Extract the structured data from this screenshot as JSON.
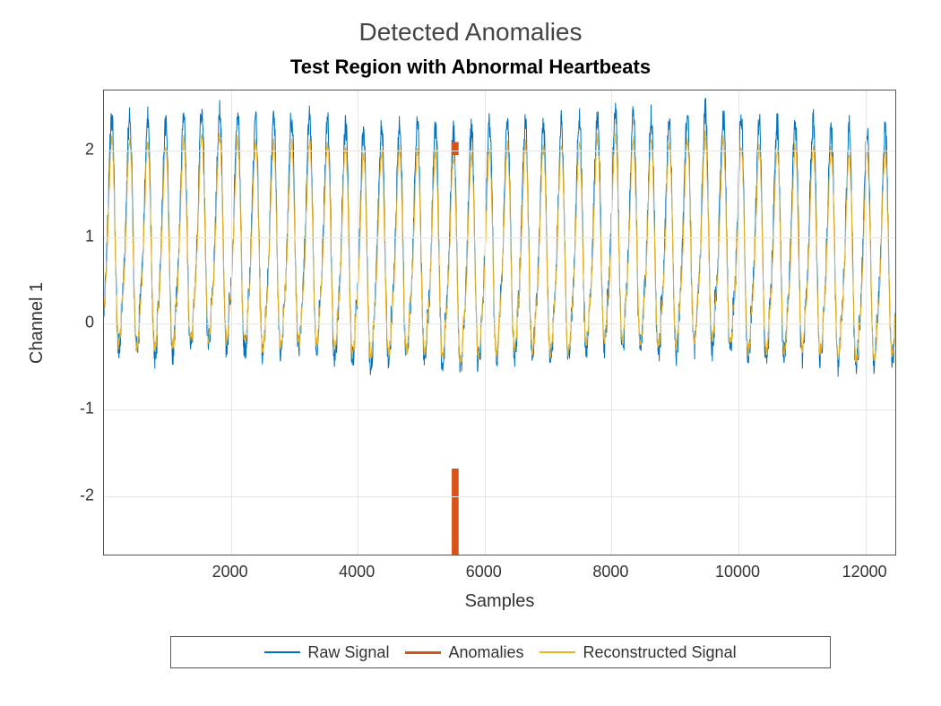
{
  "suptitle": "Detected Anomalies",
  "chart_data": {
    "type": "line",
    "title": "Test Region with Abnormal Heartbeats",
    "xlabel": "Samples",
    "ylabel": "Channel 1",
    "xlim": [
      0,
      12500
    ],
    "ylim": [
      -2.7,
      2.7
    ],
    "xticks": [
      2000,
      4000,
      6000,
      8000,
      10000,
      12000
    ],
    "yticks": [
      -2,
      -1,
      0,
      1,
      2
    ],
    "series": [
      {
        "name": "Raw Signal",
        "color": "#0072bd",
        "kind": "ecg_raw"
      },
      {
        "name": "Anomalies",
        "color": "#d95319",
        "kind": "anomaly_marker",
        "x_center": 5550,
        "top": 2.1,
        "bottom": -2.7,
        "gap": [
          -1.7,
          1.95
        ]
      },
      {
        "name": "Reconstructed Signal",
        "color": "#edb120",
        "kind": "ecg_recon"
      }
    ],
    "baseline": {
      "mean": 0.0,
      "noise_amp": 0.28,
      "drift_amp": 0.08
    },
    "beats": {
      "count": 44,
      "peak_raw": 2.45,
      "peak_recon": 2.15,
      "trough_raw": -1.0,
      "trough_recon": -0.85
    },
    "annotations": []
  },
  "legend": {
    "items": [
      "Raw Signal",
      "Anomalies",
      "Reconstructed Signal"
    ]
  }
}
